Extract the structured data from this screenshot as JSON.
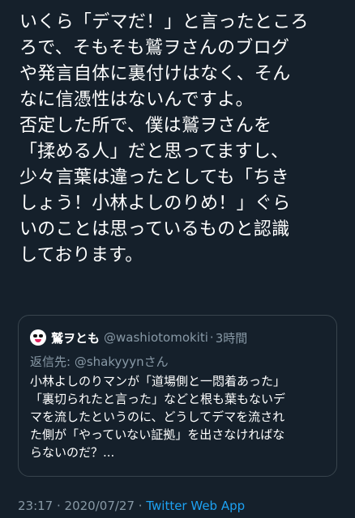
{
  "tweet": {
    "lines": [
      "いくら「デマだ！」と言ったところ",
      "ろで、そもそも鷲ヲさんのブログ",
      "や発言自体に裏付けはなく、そん",
      "なに信憑性はないんですよ。",
      "否定した所で、僕は鷲ヲさんを",
      "「揉める人」だと思ってますし、",
      "少々言葉は違ったとしても「ちき",
      "しょう！小林よしのりめ！」ぐら",
      "いのことは思っているものと認識",
      "しております。"
    ]
  },
  "quote": {
    "avatar_icon": "face-icon",
    "name": "鷲ヲとも",
    "handle": "@washiotomokiti",
    "separator": "·",
    "time": "3時間",
    "reply_prefix": "返信先: ",
    "reply_mention": "@shakyyyn",
    "reply_suffix": "さん",
    "lines": [
      "小林よしのりマンが「道場側と一悶着あった」",
      "「裏切られたと言った」などと根も葉もないデ",
      "マを流したというのに、どうしてデマを流され",
      "た側が「やっていない証拠」を出さなければな",
      "らないのだ？..."
    ]
  },
  "footer": {
    "time": "23:17",
    "separator1": " · ",
    "date": "2020/07/27",
    "separator2": " · ",
    "source": "Twitter Web App"
  },
  "colors": {
    "background": "#15202b",
    "text": "#ffffff",
    "secondary": "#8899a6",
    "link": "#1da1f2",
    "border": "#38444d"
  }
}
